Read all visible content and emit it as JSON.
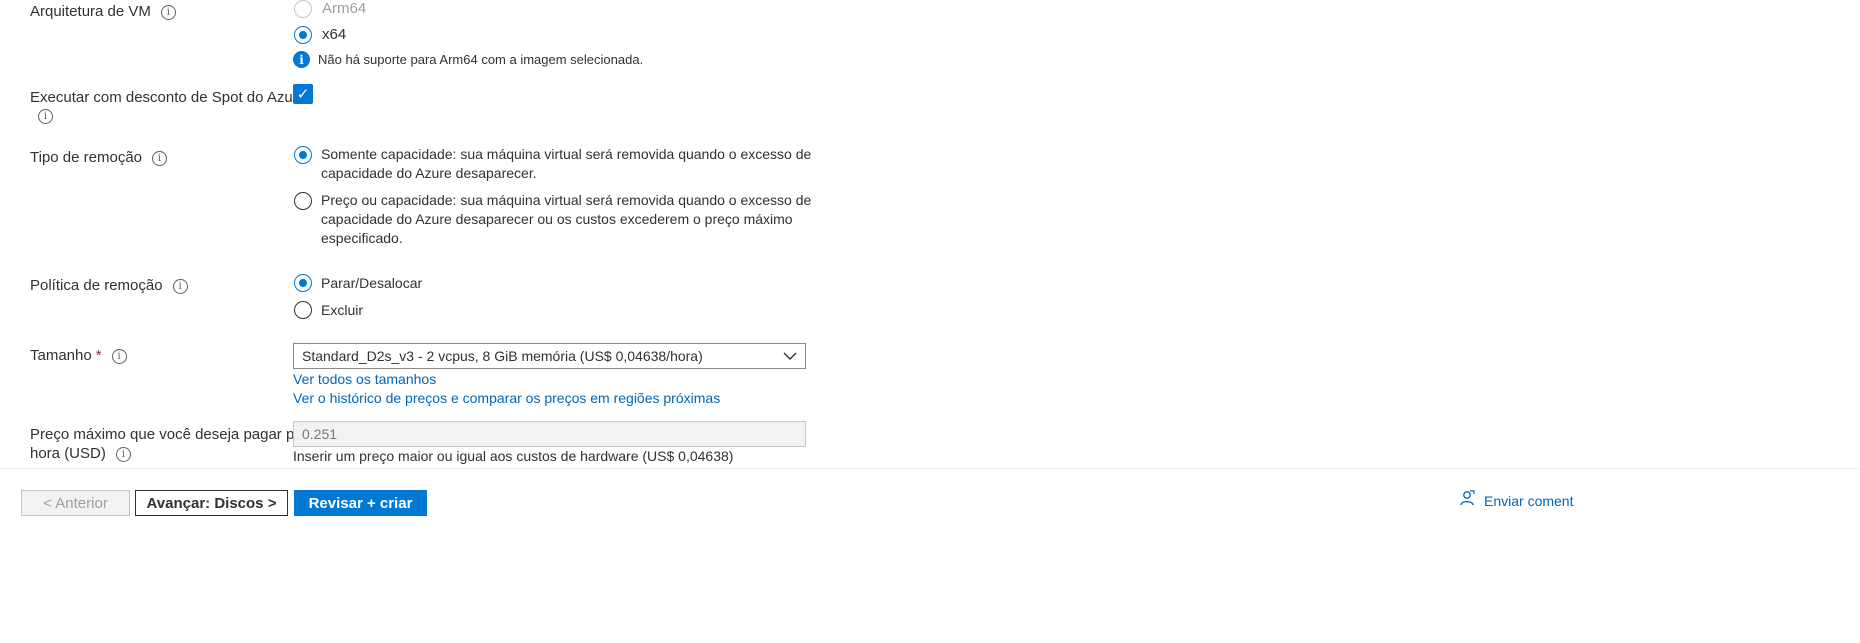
{
  "vm_architecture": {
    "label": "Arquitetura de VM",
    "options": [
      "Arm64",
      "x64"
    ],
    "selected": "x64",
    "info_message": "Não há suporte para Arm64 com a imagem selecionada."
  },
  "spot": {
    "label_line1": "Executar com desconto de Spot do Azure",
    "checked": true
  },
  "eviction_type": {
    "label": "Tipo de remoção",
    "options": [
      {
        "lines": [
          "Somente capacidade: sua máquina virtual será removida quando o excesso de",
          "capacidade do Azure desaparecer."
        ]
      },
      {
        "lines": [
          "Preço ou capacidade: sua máquina virtual será removida quando o excesso de",
          "capacidade do Azure desaparecer ou os custos excederem o preço máximo",
          "especificado."
        ]
      }
    ],
    "selected_index": 0
  },
  "eviction_policy": {
    "label": "Política de remoção",
    "options": [
      "Parar/Desalocar",
      "Excluir"
    ],
    "selected": "Parar/Desalocar"
  },
  "size": {
    "label": "Tamanho",
    "required_marker": "*",
    "value": "Standard_D2s_v3 - 2 vcpus, 8 GiB memória (US$ 0,04638/hora)",
    "link_all_sizes": "Ver todos os tamanhos",
    "link_price_history": "Ver o histórico de preços e comparar os preços em regiões próximas"
  },
  "max_price": {
    "label_line1": "Preço máximo que você deseja pagar por",
    "label_line2": "hora (USD)",
    "placeholder": "0.251",
    "hint": "Inserir um preço maior ou igual aos custos de hardware (US$ 0,04638)"
  },
  "footer": {
    "previous_label": "< Anterior",
    "next_label": "Avançar: Discos >",
    "review_label": "Revisar + criar",
    "feedback_label": "Enviar coment"
  },
  "icons": {
    "info": "info-icon",
    "check": "checkmark-icon",
    "chevron": "chevron-down-icon",
    "feedback": "feedback-icon"
  },
  "colors": {
    "accent": "#0078d4",
    "link": "#0067b8",
    "required": "#a4262c"
  }
}
